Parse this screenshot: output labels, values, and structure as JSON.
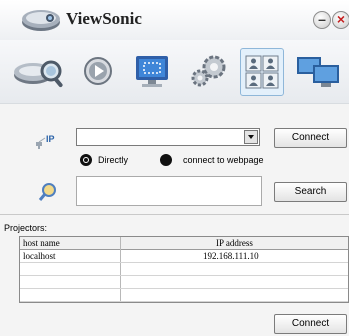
{
  "window": {
    "title": "ViewSonic",
    "minimize": "–",
    "close": "×"
  },
  "toolbar": {
    "items": [
      {
        "icon": "projector-search-icon"
      },
      {
        "icon": "play-icon"
      },
      {
        "icon": "monitor-capture-icon"
      },
      {
        "icon": "gear-icon"
      },
      {
        "icon": "multi-user-icon",
        "selected": true
      },
      {
        "icon": "network-monitors-icon"
      }
    ]
  },
  "form": {
    "ip_icon_text": "IP",
    "combo_value": "",
    "connect_label": "Connect",
    "radio_directly": "Directly",
    "radio_webpage": "connect to webpage",
    "search_value": "",
    "search_label": "Search"
  },
  "projectors": {
    "label": "Projectors:",
    "columns": [
      "host name",
      "IP address"
    ],
    "rows": [
      {
        "host": "localhost",
        "ip": "192.168.111.10"
      }
    ],
    "connect_label": "Connect"
  }
}
